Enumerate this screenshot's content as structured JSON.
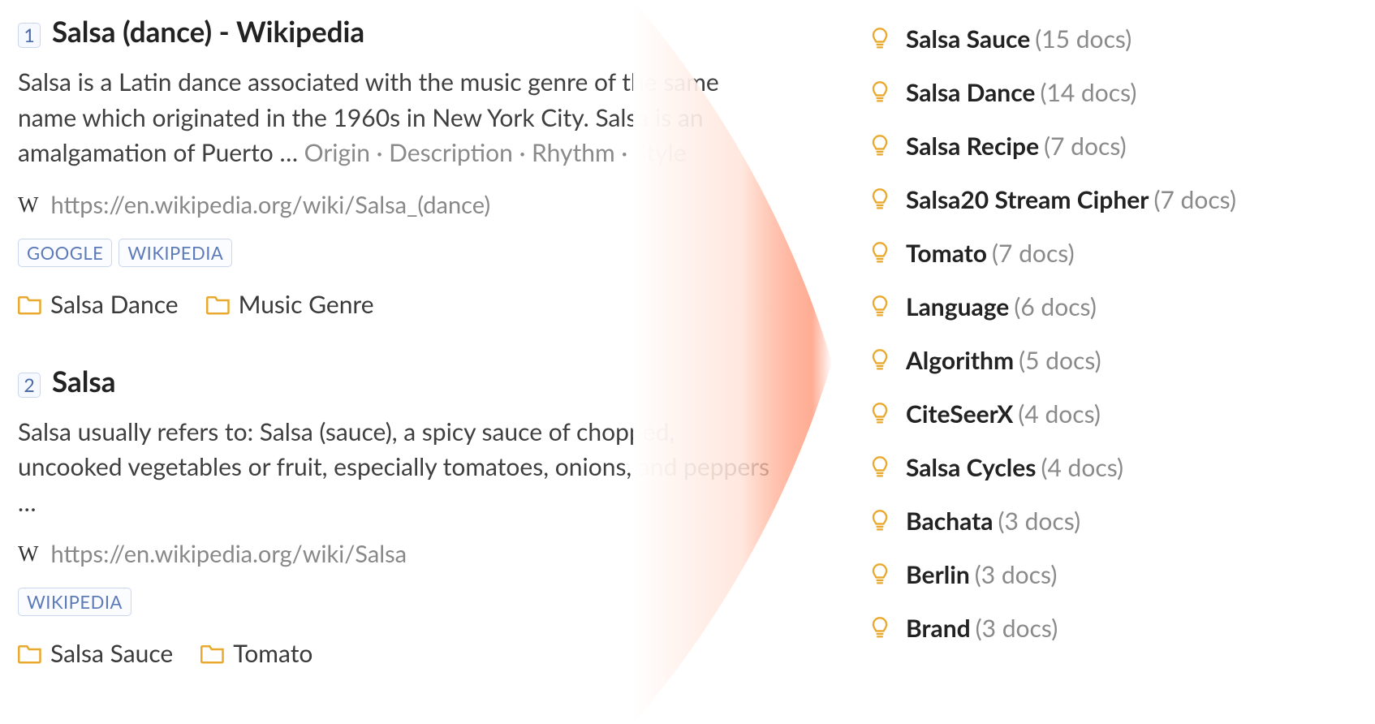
{
  "results": [
    {
      "rank": "1",
      "title": "Salsa (dance) - Wikipedia",
      "snippet_main": "Salsa is a Latin dance associated with the music genre of the same name which originated in the 1960s in New York City. Salsa is an amalgamation of Puerto … ",
      "snippet_sub": "Origin · Description · Rhythm · Style",
      "site_icon": "W",
      "url": "https://en.wikipedia.org/wiki/Salsa_(dance)",
      "source_tags": [
        "GOOGLE",
        "WIKIPEDIA"
      ],
      "folders": [
        "Salsa Dance",
        "Music Genre"
      ]
    },
    {
      "rank": "2",
      "title": "Salsa",
      "snippet_main": "Salsa usually refers to: Salsa (sauce), a spicy sauce of chopped, uncooked vegetables or fruit, especially tomatoes, onions, and peppers …",
      "snippet_sub": "",
      "site_icon": "W",
      "url": "https://en.wikipedia.org/wiki/Salsa",
      "source_tags": [
        "WIKIPEDIA"
      ],
      "folders": [
        "Salsa Sauce",
        "Tomato"
      ]
    }
  ],
  "concepts": [
    {
      "label": "Salsa Sauce",
      "count": "(15 docs)"
    },
    {
      "label": "Salsa Dance",
      "count": "(14 docs)"
    },
    {
      "label": "Salsa Recipe",
      "count": "(7 docs)"
    },
    {
      "label": "Salsa20 Stream Cipher",
      "count": "(7 docs)"
    },
    {
      "label": "Tomato",
      "count": "(7 docs)"
    },
    {
      "label": "Language",
      "count": "(6 docs)"
    },
    {
      "label": "Algorithm",
      "count": "(5 docs)"
    },
    {
      "label": "CiteSeerX",
      "count": "(4 docs)"
    },
    {
      "label": "Salsa Cycles",
      "count": "(4 docs)"
    },
    {
      "label": "Bachata",
      "count": "(3 docs)"
    },
    {
      "label": "Berlin",
      "count": "(3 docs)"
    },
    {
      "label": "Brand",
      "count": "(3 docs)"
    }
  ]
}
